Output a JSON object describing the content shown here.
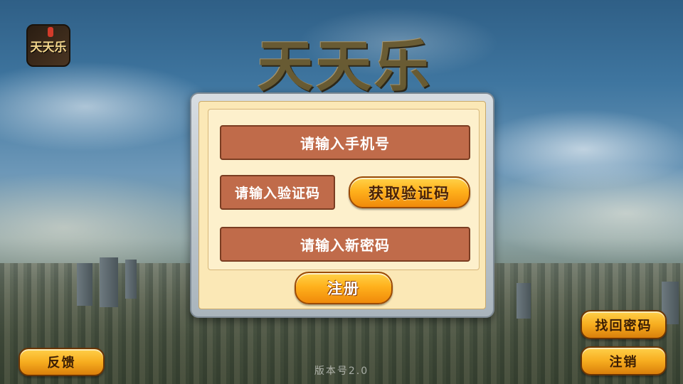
{
  "app": {
    "icon_label": "天天乐",
    "logo_text": "天天乐"
  },
  "form": {
    "phone_placeholder": "请输入手机号",
    "code_placeholder": "请输入验证码",
    "get_code_label": "获取验证码",
    "password_placeholder": "请输入新密码",
    "register_label": "注册"
  },
  "footer": {
    "feedback_label": "反馈",
    "recover_password_label": "找回密码",
    "logout_label": "注销",
    "version_text": "版本号2.0"
  },
  "colors": {
    "field_bg": "#c06b4a",
    "dialog_bg": "#fbe8b6",
    "button_orange": "#ffb11c"
  }
}
